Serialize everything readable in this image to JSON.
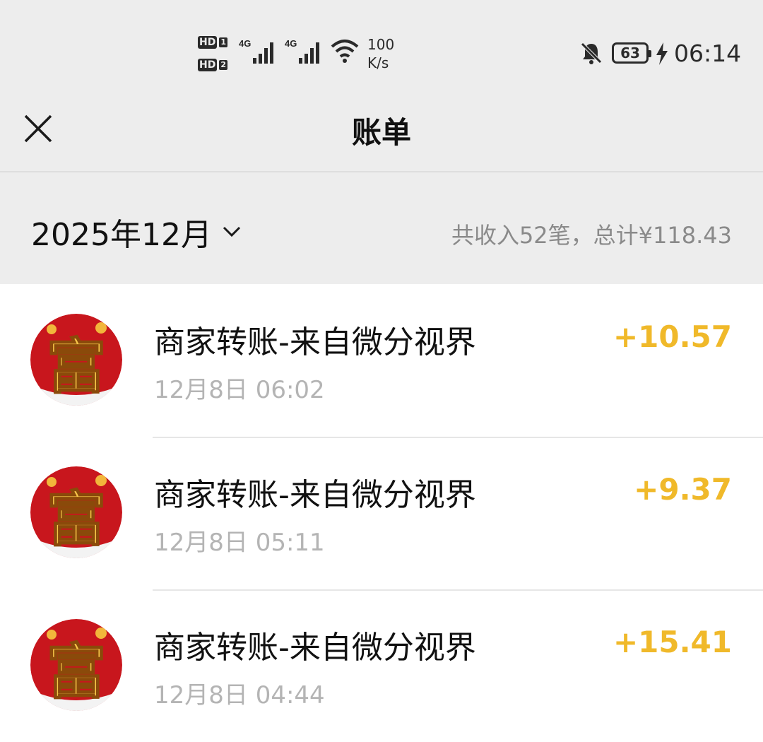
{
  "status_bar": {
    "sim1_label": "HD",
    "sim1_num": "1",
    "sim2_label": "HD",
    "sim2_num": "2",
    "network1": "4G",
    "network2": "4G",
    "speed_value": "100",
    "speed_unit": "K/s",
    "battery": "63",
    "time": "06:14",
    "icons": [
      "signal-icon",
      "wifi-icon",
      "bell-off-icon",
      "battery-icon",
      "charging-bolt-icon"
    ]
  },
  "header": {
    "title": "账单",
    "close_icon": "close-icon"
  },
  "filter": {
    "month_label": "2025年12月",
    "dropdown_icon": "chevron-down-icon",
    "summary": "共收入52笔，总计¥118.43"
  },
  "transactions": [
    {
      "name": "商家转账-来自微分视界",
      "time": "12月8日 06:02",
      "amount": "+10.57"
    },
    {
      "name": "商家转账-来自微分视界",
      "time": "12月8日 05:11",
      "amount": "+9.37"
    },
    {
      "name": "商家转账-来自微分视界",
      "time": "12月8日 04:44",
      "amount": "+15.41"
    }
  ],
  "colors": {
    "income": "#f0b92a",
    "avatar_bg": "#c8161d",
    "avatar_glyph": "#f7c64a"
  }
}
